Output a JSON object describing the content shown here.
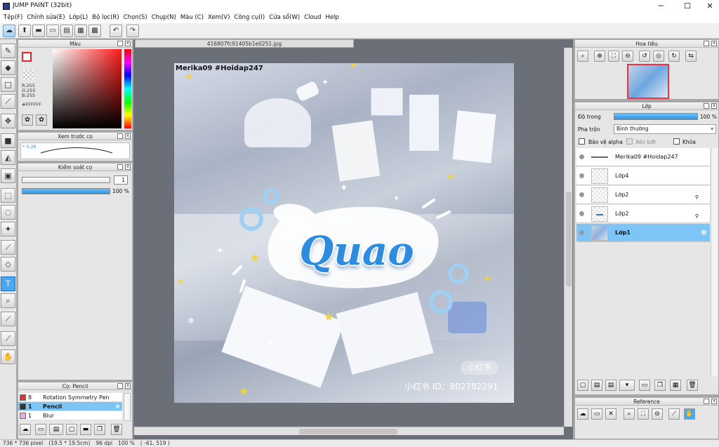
{
  "window": {
    "title": "JUMP PAINT (32bit)",
    "minimize": "─",
    "maximize": "☐",
    "close": "✕"
  },
  "menu": [
    "Tệp(F)",
    "Chỉnh sửa(E)",
    "Lớp(L)",
    "Bộ lọc(R)",
    "Chọn(S)",
    "Chụp(N)",
    "Màu (C)",
    "Xem(V)",
    "Công cụ(I)",
    "Cửa sổ(W)",
    "Cloud",
    "Help"
  ],
  "panels": {
    "color": {
      "title": "Màu",
      "r": "R:255",
      "g": "G:255",
      "b": "B:255",
      "hex": "#FFFFFF"
    },
    "brush_preview": {
      "title": "Xem trước cọ",
      "size": "0.26"
    },
    "brush_control": {
      "title": "Kiểm soát cọ",
      "size_value": "1",
      "opacity": "100 %"
    },
    "brush_list": {
      "title": "Cọ: Pencil",
      "items": [
        {
          "num": "8",
          "name": "Rotation Symmetry Pen",
          "color": "#e83030"
        },
        {
          "num": "1",
          "name": "Pencil",
          "color": "#333333",
          "selected": true
        },
        {
          "num": "1",
          "name": "Blur",
          "color": "#f0a8e8"
        }
      ]
    },
    "navigator": {
      "title": "Hoa tiêu"
    },
    "layer": {
      "title": "Lớp",
      "opacity_label": "Độ trong",
      "opacity_value": "100 %",
      "blend_label": "Pha trộn",
      "blend_value": "Bình thường",
      "protect_alpha": "Bảo vệ alpha",
      "clip": "Xén bớt",
      "lock": "Khóa",
      "opacity_fill": 1.0,
      "layers": [
        {
          "name": "Merika09 #Hoidap247",
          "kind": "text"
        },
        {
          "name": "Lớp4",
          "kind": "raster"
        },
        {
          "name": "Lớp2",
          "kind": "raster"
        },
        {
          "name": "Lớp2",
          "kind": "raster"
        },
        {
          "name": "Lớp1",
          "kind": "raster",
          "selected": true
        }
      ]
    },
    "reference": {
      "title": "Reference"
    }
  },
  "document": {
    "tab": "416807fc91405b1e0251.jpg",
    "watermark": "Merika09 #Hoidap247",
    "title_art": "Quao",
    "id_text": "小红书 ID：802782291",
    "logo": "小红书"
  },
  "status": {
    "size": "736 * 736 pixel",
    "dims": "(19.5 * 19.5cm)",
    "dpi": "96 dpi",
    "zoom": "100 %",
    "coords": "( -61, 519 )"
  },
  "colors": {
    "accent": "#4aa7f2",
    "selected_layer": "#7ec5f7",
    "canvas_bg": "#6b7078"
  }
}
